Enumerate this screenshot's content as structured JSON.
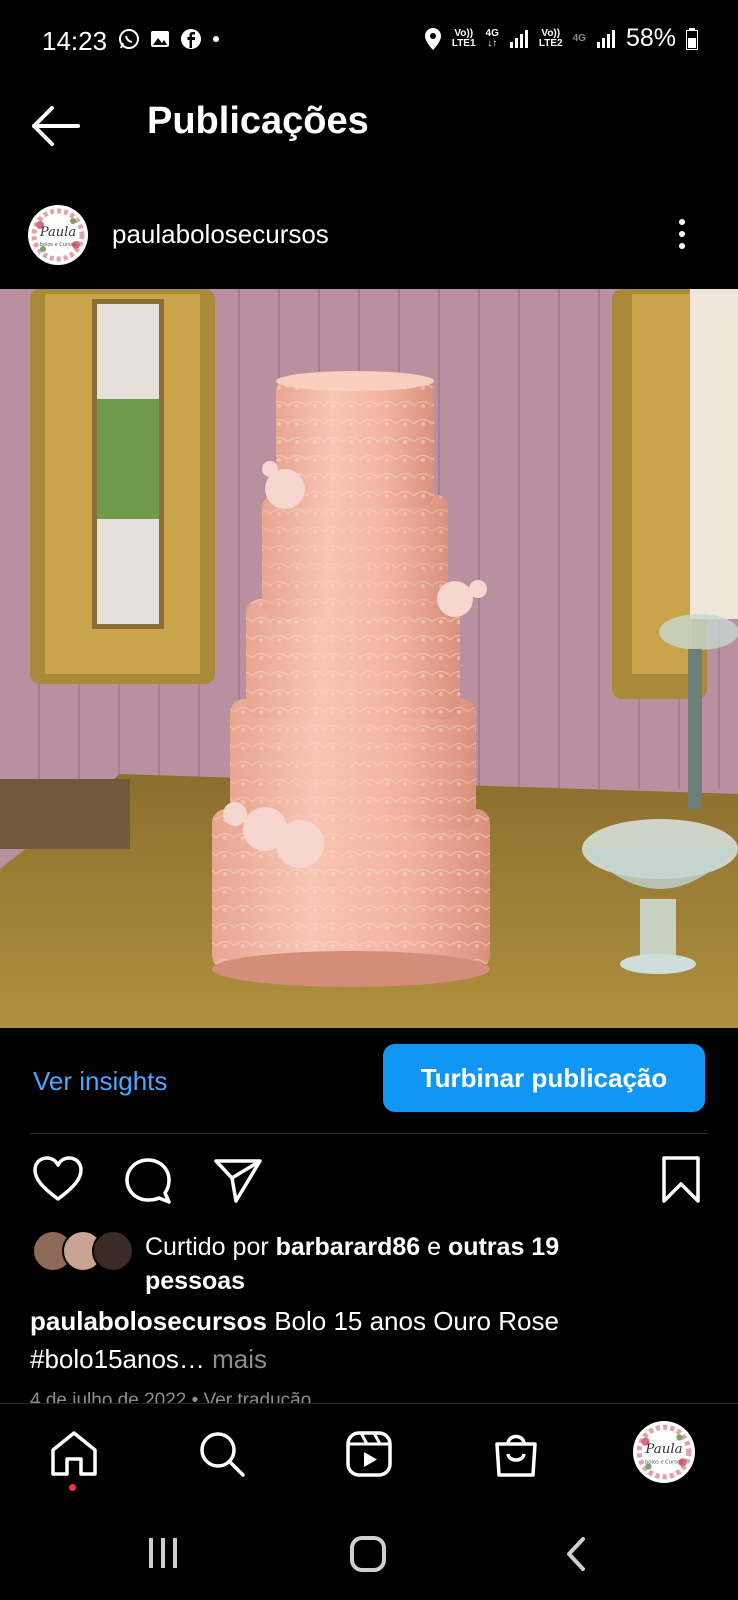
{
  "status_bar": {
    "time": "14:23",
    "battery_percent": "58%",
    "sim1_label_top": "Vo))",
    "sim1_label_bottom": "LTE1",
    "sim1_net": "4G",
    "sim2_label_top": "Vo))",
    "sim2_label_bottom": "LTE2",
    "sim2_net": "4G",
    "notification_icons": [
      "whatsapp-icon",
      "gallery-icon",
      "facebook-icon",
      "dot-icon"
    ]
  },
  "header": {
    "title": "Publicações"
  },
  "post": {
    "username": "paulabolosecursos",
    "avatar_text_main": "Paula",
    "avatar_text_sub": "bolos e Cursos",
    "insights_label": "Ver insights",
    "boost_label": "Turbinar publicação",
    "likes": {
      "prefix": "Curtido por ",
      "user": "barbarard86",
      "connector": " e ",
      "others_line1": "outras 19",
      "others_line2": "pessoas"
    },
    "caption": {
      "user": "paulabolosecursos",
      "text": " Bolo 15 anos Ouro Rose",
      "line2": "#bolo15anos…",
      "more": " mais"
    },
    "date_line": "4 de julho de 2022 • Ver tradução"
  },
  "colors": {
    "accent_blue": "#1296f5",
    "link_blue": "#4aa7ff",
    "cake": "#f3b49f",
    "wall": "#b88f9e",
    "table": "#9a7a33",
    "notification_dot": "#ff3040"
  }
}
